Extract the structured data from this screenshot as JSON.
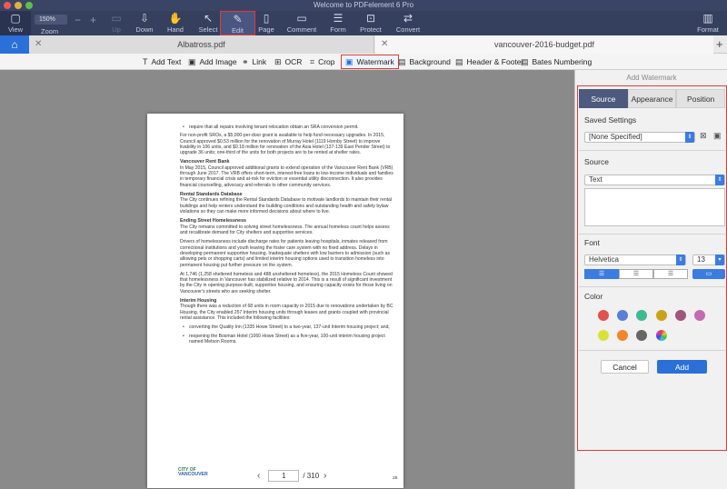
{
  "window": {
    "title": "Welcome to PDFelement 6 Pro",
    "colors": {
      "toolbar": "#35405f",
      "accent": "#2b6fd8",
      "highlight": "#e23a3a"
    }
  },
  "toolbar": {
    "zoom_value": "150%",
    "zoom_label": "Zoom",
    "zoom_minus": "−",
    "zoom_plus": "+",
    "items": [
      {
        "label": "View",
        "icon": "sidebar-icon"
      },
      {
        "label": "Up",
        "icon": "arrow-up-icon"
      },
      {
        "label": "Down",
        "icon": "arrow-down-icon"
      },
      {
        "label": "Hand",
        "icon": "hand-icon"
      },
      {
        "label": "Select",
        "icon": "cursor-icon"
      },
      {
        "label": "Edit",
        "icon": "edit-icon"
      },
      {
        "label": "Page",
        "icon": "page-icon"
      },
      {
        "label": "Comment",
        "icon": "comment-icon"
      },
      {
        "label": "Form",
        "icon": "form-icon"
      },
      {
        "label": "Protect",
        "icon": "lock-icon"
      },
      {
        "label": "Convert",
        "icon": "convert-icon"
      },
      {
        "label": "Format",
        "icon": "format-icon"
      }
    ]
  },
  "tabs": [
    {
      "label": "Albatross.pdf"
    },
    {
      "label": "vancouver-2016-budget.pdf"
    }
  ],
  "edit_toolbar": {
    "items": [
      "Add Text",
      "Add Image",
      "Link",
      "OCR",
      "Crop",
      "Watermark",
      "Background",
      "Header & Footer",
      "Bates Numbering"
    ]
  },
  "document": {
    "p1": "require that all repairs involving tenant relocation obtain an SRA conversion permit.",
    "p2": "For non-profit SROs, a $5,000-per-door grant is available to help fund necessary upgrades. In 2015, Council approved $0.53 million for the renovation of Murray Hotel (1119 Hornby Street) to improve livability in 106 units, and $0.18 million for renovation of the Asia Hotel (137-139 East Pender Street) to upgrade 36 units; one-third of the units for both projects are to be rented at shelter rates.",
    "h1": "Vancouver Rent Bank",
    "p3": "In May 2015, Council approved additional grants to extend operation of the Vancouver Rent Bank (VRB) through June 2017. The VRB offers short-term, interest-free loans to low-income individuals and families in temporary financial crisis and at-risk for eviction or essential utility disconnection. It also provides financial counselling, advocacy and referrals to other community services.",
    "h2": "Rental Standards Database",
    "p4": "The City continues refining the Rental Standards Database to motivate landlords to maintain their rental buildings and help renters understand the building conditions and outstanding health and safety bylaw violations so they can make more informed decisions about where to live.",
    "h3": "Ending Street Homelessness",
    "p5": "The City remains committed to solving street homelessness. The annual homeless count helps assess and recalibrate demand for City shelters and supportive services.",
    "p6": "Drivers of homelessness include discharge rates for patients leaving hospitals, inmates released from correctional institutions and youth leaving the foster care system with no fixed address. Delays in developing permanent supportive housing. Inadequate shelters with low barriers to admission (such as allowing pets or shopping carts) and limited interim housing options used to transition homeless into permanent housing put further pressure on the system.",
    "p7": "At 1,746 (1,258 sheltered homeless and 488 unsheltered homeless), the 2015 Homeless Count showed that homelessness in Vancouver has stabilized relative to 2014. This is a result of significant investment by the City in opening purpose-built, supportive housing, and ensuring capacity exists for those living on Vancouver's streets who are seeking shelter.",
    "h4": "Interim Housing",
    "p8": "Though there was a reduction of 68 units in room capacity in 2015 due to renovations undertaken by BC Housing, the City enabled 257 Interim housing units through leases and grants coupled with provincial rental assistance. This included the following facilities:",
    "b1": "converting the Quality Inn (1335 Howe Street) to a two-year, 137-unit Interim housing project; and,",
    "b2": "reopening the Bosman Hotel (1060 Howe Street) as a five-year, 100-unit interim housing project named Metson Rooms.",
    "logo_top": "CITY OF",
    "logo_bottom": "VANCOUVER",
    "page_label": "28"
  },
  "pager": {
    "current": "1",
    "separator": "/ 310"
  },
  "panel": {
    "title": "Add Watermark",
    "tabs": [
      "Source",
      "Appearance",
      "Position"
    ],
    "saved_settings_label": "Saved Settings",
    "saved_settings_value": "[None Specified]",
    "source_label": "Source",
    "source_value": "Text",
    "font_label": "Font",
    "font_value": "Helvetica",
    "font_size": "13",
    "color_label": "Color",
    "colors": [
      "#e05252",
      "#5a7fd6",
      "#3fb990",
      "#c9a21a",
      "#a0557a",
      "#c46ab2",
      "#d9e23a",
      "#f0872b",
      "#666666",
      "#c84fb8"
    ],
    "cancel_label": "Cancel",
    "add_label": "Add"
  }
}
